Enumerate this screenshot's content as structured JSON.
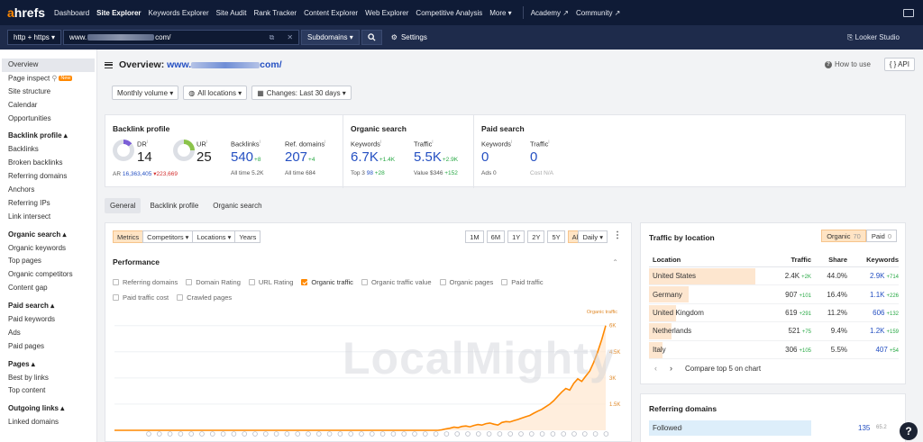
{
  "brand": {
    "logo_a": "a",
    "logo_rest": "hrefs"
  },
  "topnav": {
    "items": [
      "Dashboard",
      "Site Explorer",
      "Keywords Explorer",
      "Site Audit",
      "Rank Tracker",
      "Content Explorer",
      "Web Explorer",
      "Competitive Analysis",
      "More ▾"
    ],
    "academy": "Academy ↗",
    "community": "Community ↗"
  },
  "subbar": {
    "protocol": "http + https ▾",
    "url_start": "www.",
    "url_end": "com/",
    "subdomains": "Subdomains ▾",
    "settings": "Settings",
    "looker": "Looker Studio"
  },
  "sidebar": {
    "overview": "Overview",
    "page_inspect": "Page inspect",
    "new_badge": "New",
    "site_structure": "Site structure",
    "calendar": "Calendar",
    "opportunities": "Opportunities",
    "backlink_head": "Backlink profile ▴",
    "backlink_items": [
      "Backlinks",
      "Broken backlinks",
      "Referring domains",
      "Anchors",
      "Referring IPs",
      "Link intersect"
    ],
    "organic_head": "Organic search ▴",
    "organic_items": [
      "Organic keywords",
      "Top pages",
      "Organic competitors",
      "Content gap"
    ],
    "paid_head": "Paid search ▴",
    "paid_items": [
      "Paid keywords",
      "Ads",
      "Paid pages"
    ],
    "pages_head": "Pages ▴",
    "pages_items": [
      "Best by links",
      "Top content"
    ],
    "outgoing_head": "Outgoing links ▴",
    "outgoing_items": [
      "Linked domains"
    ]
  },
  "header": {
    "title_prefix": "Overview:",
    "url_start": "www.",
    "url_end": "com/",
    "how_to": "How to use",
    "api": "{ } API"
  },
  "filters": {
    "monthly": "Monthly volume ▾",
    "locations": "All locations ▾",
    "changes": "Changes: Last 30 days ▾"
  },
  "backlink_profile": {
    "title": "Backlink profile",
    "dr_label": "DR",
    "dr_value": "14",
    "ur_label": "UR",
    "ur_value": "25",
    "ar_label": "AR",
    "ar_value": "16,363,405",
    "ar_delta": "▾223,669",
    "backlinks_label": "Backlinks",
    "backlinks_value": "540",
    "backlinks_delta": "+8",
    "backlinks_all": "All time 5.2K",
    "refdomains_label": "Ref. domains",
    "refdomains_value": "207",
    "refdomains_delta": "+4",
    "refdomains_all": "All time 684"
  },
  "organic": {
    "title": "Organic search",
    "kw_label": "Keywords",
    "kw_value": "6.7K",
    "kw_delta": "+1.4K",
    "kw_top3_label": "Top 3",
    "kw_top3": "98",
    "kw_top3_delta": "+28",
    "tr_label": "Traffic",
    "tr_value": "5.5K",
    "tr_delta": "+2.9K",
    "tr_value_label": "Value",
    "tr_val": "$346",
    "tr_val_delta": "+152"
  },
  "paid": {
    "title": "Paid search",
    "kw_label": "Keywords",
    "kw_value": "0",
    "ads": "Ads 0",
    "tr_label": "Traffic",
    "tr_value": "0",
    "cost": "Cost N/A"
  },
  "tabs": [
    "General",
    "Backlink profile",
    "Organic search"
  ],
  "chart_controls": {
    "metrics": "Metrics",
    "competitors": "Competitors ▾",
    "locations": "Locations ▾",
    "years": "Years",
    "ranges": [
      "1M",
      "6M",
      "1Y",
      "2Y",
      "5Y",
      "All"
    ],
    "daily": "Daily ▾",
    "performance": "Performance"
  },
  "checkboxes": [
    {
      "label": "Referring domains",
      "checked": false
    },
    {
      "label": "Domain Rating",
      "checked": false
    },
    {
      "label": "URL Rating",
      "checked": false
    },
    {
      "label": "Organic traffic",
      "checked": true
    },
    {
      "label": "Organic traffic value",
      "checked": false
    },
    {
      "label": "Organic pages",
      "checked": false
    },
    {
      "label": "Paid traffic",
      "checked": false
    },
    {
      "label": "Paid traffic cost",
      "checked": false
    },
    {
      "label": "Crawled pages",
      "checked": false
    }
  ],
  "chart_data": {
    "type": "line",
    "series": [
      {
        "name": "Organic traffic",
        "color": "#ff8800",
        "values": [
          0,
          0,
          0,
          0,
          0,
          0,
          0,
          0,
          0,
          0,
          0,
          0,
          0,
          0,
          0,
          0,
          0,
          0,
          0,
          0,
          0,
          0,
          0,
          0,
          0,
          0,
          0,
          0,
          0,
          0,
          0,
          0,
          0,
          0,
          0,
          0,
          0,
          0,
          0,
          0,
          0,
          0,
          0,
          0,
          0,
          0,
          0,
          0,
          0,
          0,
          0,
          0,
          0,
          0,
          0,
          0,
          0,
          0,
          0,
          0,
          0,
          0,
          0,
          0,
          0,
          0,
          0,
          0,
          0,
          0,
          0,
          0,
          0,
          0,
          0,
          0,
          0,
          0,
          0,
          0,
          0,
          0,
          30,
          80,
          120,
          180,
          150,
          220,
          250,
          200,
          280,
          330,
          300,
          380,
          420,
          350,
          300,
          450,
          500,
          480,
          550,
          620,
          700,
          780,
          850,
          980,
          1100,
          1200,
          1350,
          1500,
          1700,
          1950,
          2200,
          2400,
          2300,
          2700,
          2950,
          2800,
          3100,
          3400,
          3900,
          4500,
          5200,
          6000
        ]
      }
    ],
    "yticks": [
      "1.5K",
      "3K",
      "4.5K",
      "6K"
    ],
    "ylim": [
      0,
      6500
    ],
    "legend": "Organic traffic"
  },
  "watermark": "LocalMighty",
  "traffic_by_location": {
    "title": "Traffic by location",
    "organic_label": "Organic",
    "organic_count": "70",
    "paid_label": "Paid",
    "paid_count": "0",
    "headers": [
      "Location",
      "Traffic",
      "Share",
      "Keywords"
    ],
    "rows": [
      {
        "location": "United States",
        "traffic": "2.4K",
        "traffic_delta": "+2K",
        "share": "44.0%",
        "keywords": "2.9K",
        "kw_delta": "+714",
        "share_value": 44.0
      },
      {
        "location": "Germany",
        "traffic": "907",
        "traffic_delta": "+101",
        "share": "16.4%",
        "keywords": "1.1K",
        "kw_delta": "+226",
        "share_value": 16.4
      },
      {
        "location": "United Kingdom",
        "traffic": "619",
        "traffic_delta": "+291",
        "share": "11.2%",
        "keywords": "606",
        "kw_delta": "+132",
        "share_value": 11.2
      },
      {
        "location": "Netherlands",
        "traffic": "521",
        "traffic_delta": "+75",
        "share": "9.4%",
        "keywords": "1.2K",
        "kw_delta": "+159",
        "share_value": 9.4
      },
      {
        "location": "Italy",
        "traffic": "306",
        "traffic_delta": "+105",
        "share": "5.5%",
        "keywords": "407",
        "kw_delta": "+54",
        "share_value": 5.5
      }
    ],
    "compare": "Compare top 5 on chart"
  },
  "referring_domains": {
    "title": "Referring domains",
    "followed": "Followed",
    "followed_value": "135",
    "followed_pct": "65.2"
  }
}
